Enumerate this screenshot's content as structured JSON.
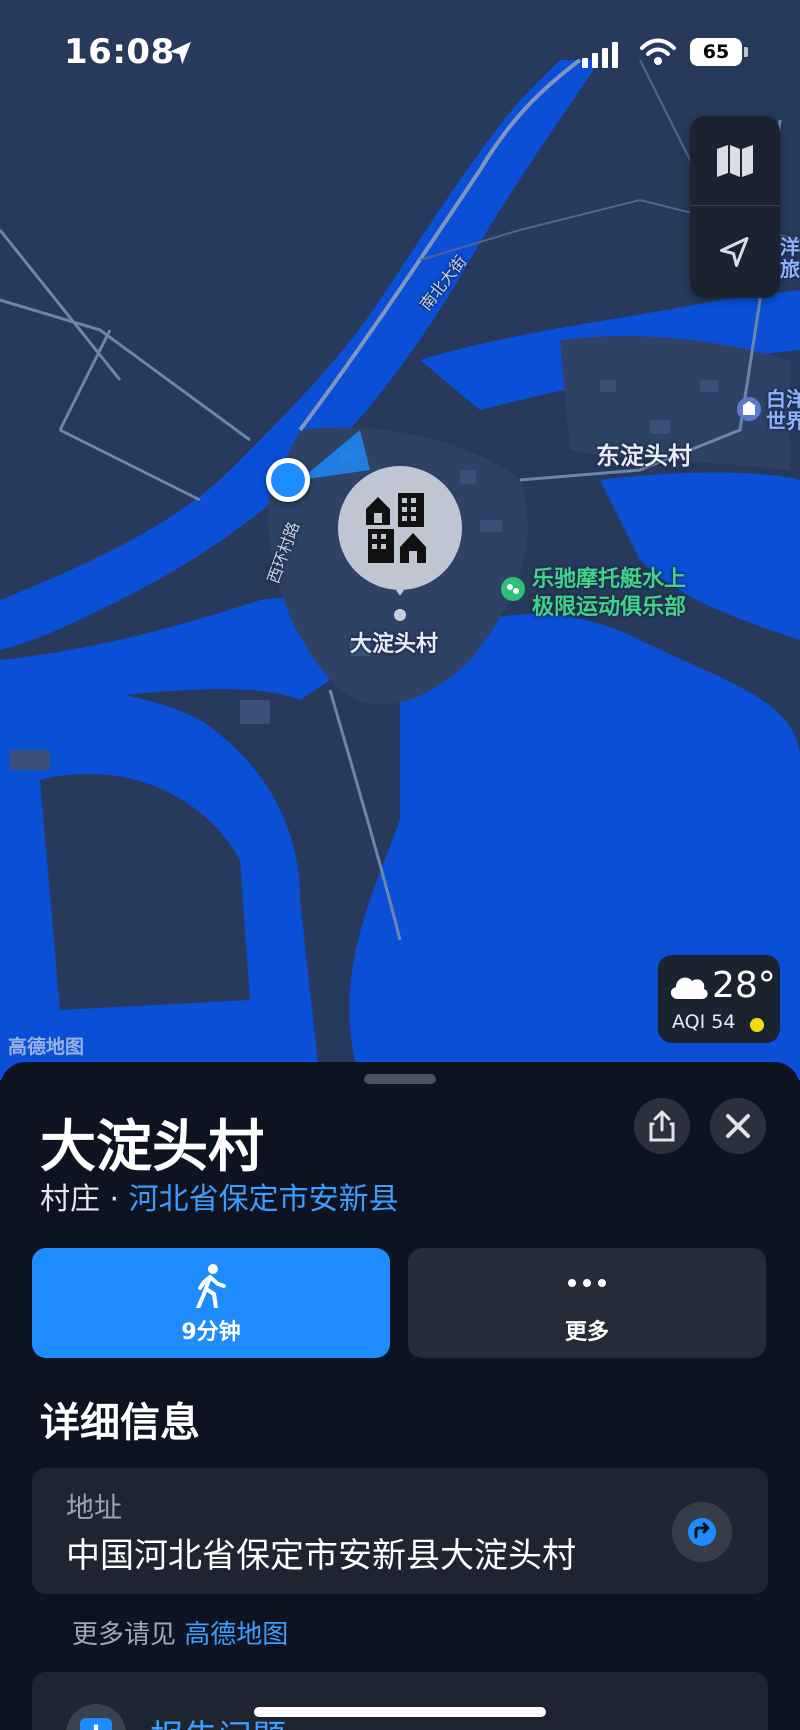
{
  "status_bar": {
    "time": "16:08",
    "battery": "65"
  },
  "map": {
    "labels": {
      "road_nanbei": "南北大街",
      "road_xihuan": "西环村路",
      "village_east": "东淀头村",
      "village_main": "大淀头村",
      "club": "乐驰摩托艇水上\n极限运动俱乐部",
      "poi_right_top": "洋\n旅",
      "poi_right_mid": "白洋\n世界"
    },
    "attribution": "高德地图",
    "weather": {
      "temp": "28°",
      "aqi": "AQI 54"
    },
    "colors": {
      "water": "#0a4fd6",
      "land": "#273a5c",
      "accent": "#1e8cff"
    }
  },
  "sheet": {
    "title": "大淀头村",
    "category": "村庄",
    "separator": "·",
    "region": "河北省保定市安新县",
    "actions": {
      "walk_time": "9分钟",
      "more": "更多"
    },
    "details_title": "详细信息",
    "address": {
      "label": "地址",
      "value": "中国河北省保定市安新县大淀头村"
    },
    "more_info_prefix": "更多请见",
    "more_info_link": "高德地图",
    "report": "报告问题"
  }
}
